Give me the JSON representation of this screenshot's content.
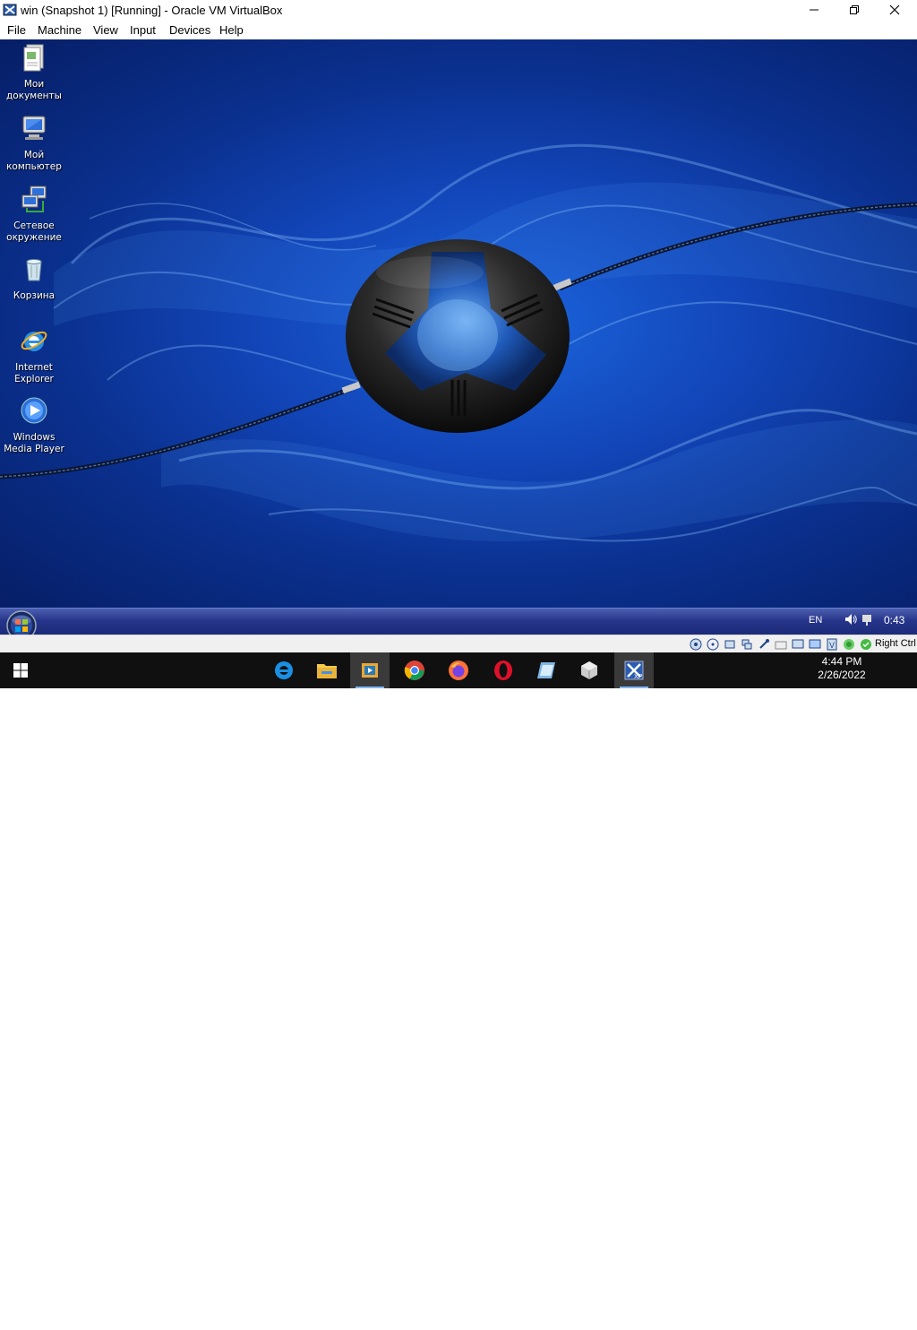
{
  "window": {
    "title": "win (Snapshot 1) [Running] - Oracle VM VirtualBox",
    "menu": [
      "File",
      "Machine",
      "View",
      "Input",
      "Devices",
      "Help"
    ]
  },
  "desktop": {
    "icons": [
      {
        "label": "Мои документы",
        "icon": "my-documents-icon"
      },
      {
        "label": "Мой компьютер",
        "icon": "my-computer-icon"
      },
      {
        "label": "Сетевое окружение",
        "icon": "network-places-icon"
      },
      {
        "label": "Корзина",
        "icon": "recycle-bin-icon"
      },
      {
        "label": "Internet Explorer",
        "icon": "internet-explorer-icon"
      },
      {
        "label": "Windows Media Player",
        "icon": "media-player-icon"
      }
    ]
  },
  "guest_taskbar": {
    "language": "EN",
    "clock": "0:43"
  },
  "vbox_status": {
    "host_key": "Right Ctrl"
  },
  "host_taskbar": {
    "apps": [
      "edge-legacy-icon",
      "file-explorer-icon",
      "media-app-icon",
      "chrome-icon",
      "firefox-icon",
      "opera-icon",
      "notepad-app-icon",
      "virtualbox-cube-icon",
      "virtualbox-xp-vm-icon"
    ],
    "time": "4:44 PM",
    "date": "2/26/2022"
  },
  "colors": {
    "desktop_blue": "#1245b8",
    "host_taskbar": "#101010",
    "guest_taskbar": "#26358a"
  }
}
